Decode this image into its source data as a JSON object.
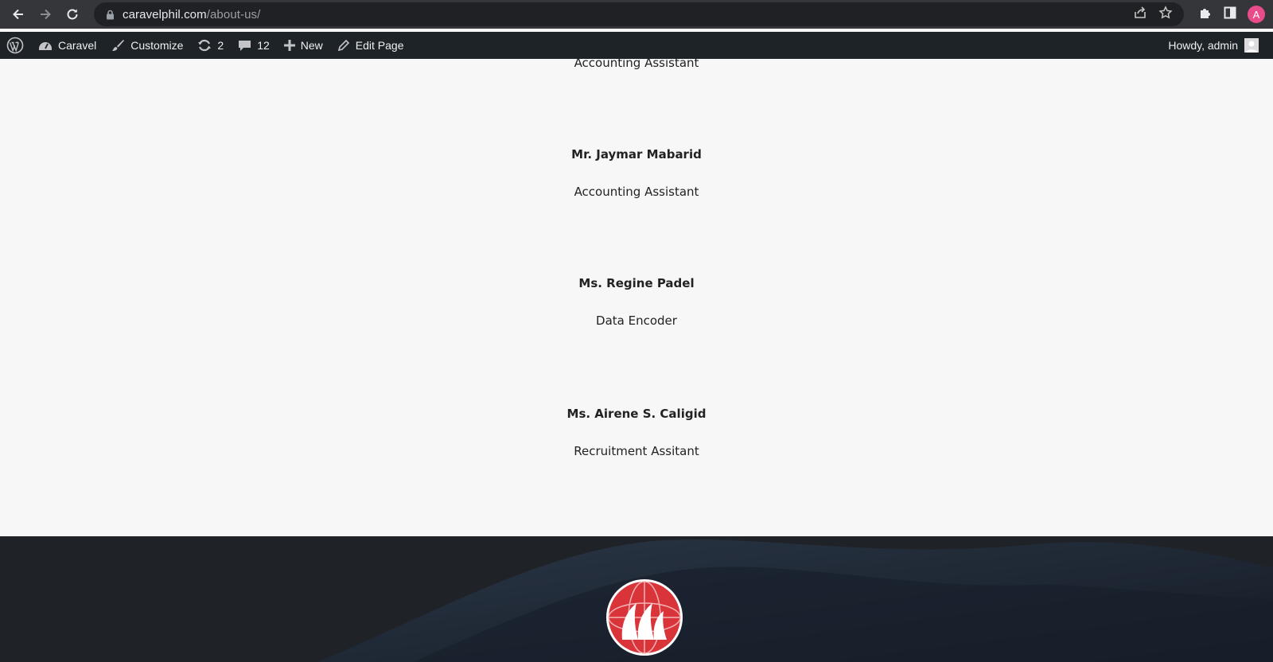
{
  "browser": {
    "url_host": "caravelphil.com",
    "url_path": "/about-us/",
    "profile_initial": "A"
  },
  "adminbar": {
    "site_name": "Caravel",
    "customize_label": "Customize",
    "updates_count": "2",
    "comments_count": "12",
    "new_label": "New",
    "edit_label": "Edit Page",
    "howdy": "Howdy, admin"
  },
  "staff": [
    {
      "name": "",
      "role": "Accounting Assistant"
    },
    {
      "name": "Mr. Jaymar Mabarid",
      "role": "Accounting Assistant"
    },
    {
      "name": "Ms. Regine Padel",
      "role": "Data Encoder"
    },
    {
      "name": "Ms. Airene S. Caligid",
      "role": "Recruitment Assitant"
    }
  ],
  "colors": {
    "browser_bar": "#35363a",
    "adminbar": "#1d2327",
    "page_bg": "#f7f7f7",
    "footer_bg": "#1f2328",
    "logo_red": "#d9343a",
    "profile": "#e84c8a"
  },
  "icons": {
    "back": "arrow-left-icon",
    "forward": "arrow-right-icon",
    "reload": "reload-icon",
    "lock": "lock-icon",
    "share": "share-icon",
    "bookmark": "star-icon",
    "extensions": "puzzle-icon",
    "sidepanel": "side-panel-icon",
    "wordpress": "wordpress-logo-icon",
    "dashboard": "dashboard-icon",
    "customize": "brush-icon",
    "updates": "updates-icon",
    "comments": "comment-icon",
    "new": "plus-icon",
    "edit": "pencil-icon"
  }
}
